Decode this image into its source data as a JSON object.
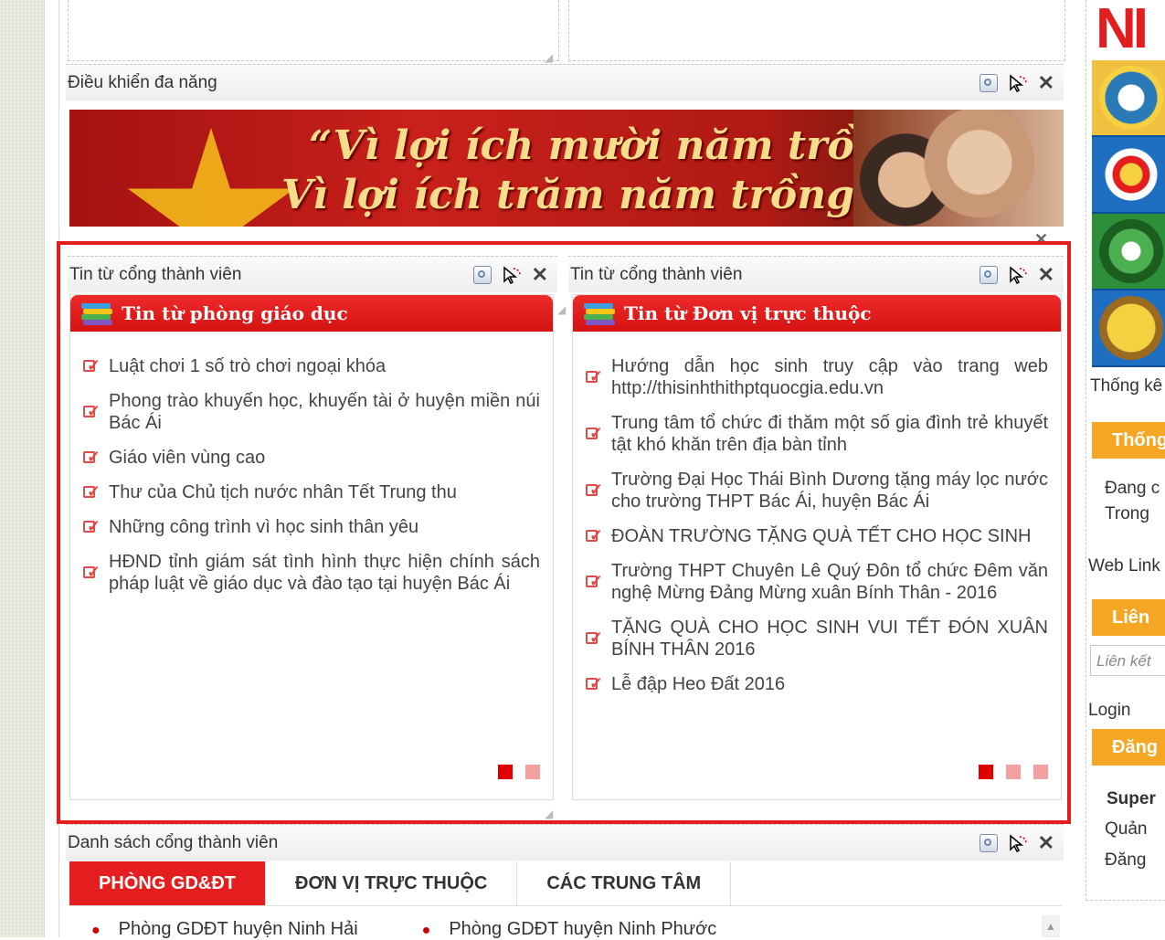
{
  "top_module": {
    "title": "Điều khiển đa năng"
  },
  "banner": {
    "line1": "“Vì lợi ích mười năm trồng cây",
    "line2": "Vì lợi ích trăm năm trồng người”"
  },
  "left_module": {
    "title": "Tin từ cổng thành viên",
    "header": "Tin từ phòng giáo dục",
    "items": [
      "Luật chơi 1 số trò chơi ngoại khóa",
      "Phong trào khuyến học, khuyến tài ở huyện miền núi Bác Ái",
      "Giáo viên vùng cao",
      "Thư của Chủ tịch nước nhân Tết Trung thu",
      "Những công trình vì học sinh thân yêu",
      "HĐND tỉnh giám sát tình hình thực hiện chính sách pháp luật về giáo dục và đào tạo tại huyện Bác Ái"
    ],
    "pages": 2,
    "current_page": 1
  },
  "right_module": {
    "title": "Tin từ cổng thành viên",
    "header": "Tin từ Đơn vị trực thuộc",
    "items": [
      "Hướng dẫn học sinh truy cập vào trang web http://thisinhthithptquocgia.edu.vn",
      "Trung tâm tổ chức đi thăm một số gia đình trẻ khuyết tật khó khăn trên địa bàn tỉnh",
      "Trường Đại Học Thái Bình Dương tặng máy lọc nước cho trường THPT Bác Ái, huyện Bác Ái",
      "ĐOÀN TRƯỜNG TẶNG QUÀ TẾT CHO HỌC SINH",
      "Trường THPT Chuyên Lê Quý Đôn tổ chức Đêm văn nghệ Mừng Đảng Mừng xuân Bính Thân - 2016",
      "TẶNG QUÀ CHO HỌC SINH VUI TẾT ĐÓN XUÂN BÍNH THÂN 2016",
      "Lễ đập Heo Đất 2016"
    ],
    "pages": 3,
    "current_page": 1
  },
  "bottom_module": {
    "title": "Danh sách cổng thành viên",
    "tabs": [
      "PHÒNG GD&ĐT",
      "ĐƠN VỊ TRỰC THUỘC",
      "CÁC TRUNG TÂM"
    ],
    "active_tab": 0,
    "list": [
      "Phòng GDĐT huyện Ninh Hải",
      "Phòng GDĐT huyện Ninh Phước"
    ]
  },
  "right_sidebar": {
    "logo_text": "NI",
    "thong_ke_label": "Thống kê",
    "thong_ke_bar": "Thống",
    "dang_label": "Đang c",
    "trong_label": "Trong",
    "web_link_label": "Web Link",
    "lien_bar": "Liên",
    "lien_ket_placeholder": "Liên kết",
    "login_label": "Login",
    "dang_bar": "Đăng",
    "super_label": "Super",
    "quan_label": "Quản",
    "dang_link": "Đăng"
  },
  "colors": {
    "accent_red": "#e41e1e",
    "orange": "#f5a623",
    "checkbox": "#e24a4a"
  },
  "icons": [
    "edit-icon",
    "move-icon",
    "close-icon",
    "books-icon",
    "checkbox-icon"
  ]
}
